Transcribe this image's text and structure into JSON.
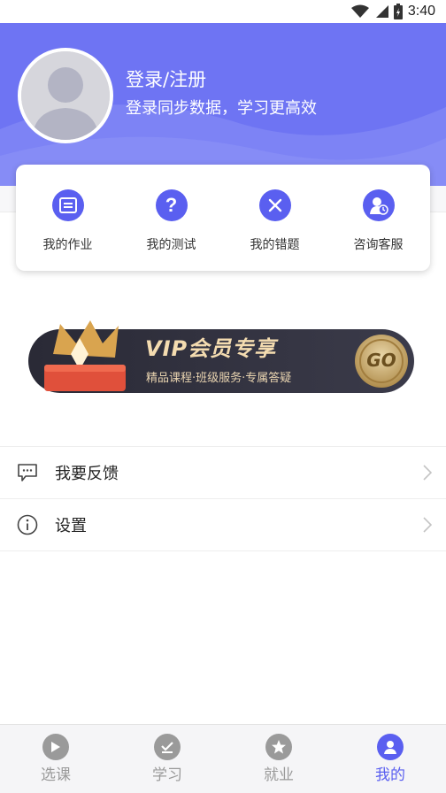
{
  "status_bar": {
    "time": "3:40"
  },
  "profile": {
    "title": "登录/注册",
    "subtitle": "登录同步数据，学习更高效"
  },
  "quick_actions": [
    {
      "label": "我的作业",
      "icon": "homework-icon"
    },
    {
      "label": "我的测试",
      "icon": "question-icon"
    },
    {
      "label": "我的错题",
      "icon": "wrong-answer-icon"
    },
    {
      "label": "咨询客服",
      "icon": "customer-service-icon"
    }
  ],
  "vip_banner": {
    "title": "VIP会员专享",
    "subtitle": "精品课程·班级服务·专属答疑",
    "go": "GO"
  },
  "menu": [
    {
      "label": "我要反馈",
      "icon": "feedback-icon"
    },
    {
      "label": "设置",
      "icon": "info-icon"
    }
  ],
  "tabs": [
    {
      "label": "选课",
      "icon": "play-icon",
      "active": false
    },
    {
      "label": "学习",
      "icon": "study-check-icon",
      "active": false
    },
    {
      "label": "就业",
      "icon": "star-icon",
      "active": false
    },
    {
      "label": "我的",
      "icon": "profile-icon",
      "active": true
    }
  ],
  "colors": {
    "accent": "#5a5ff0",
    "header": "#6e74f3",
    "tab_inactive": "#9a9a9a"
  }
}
